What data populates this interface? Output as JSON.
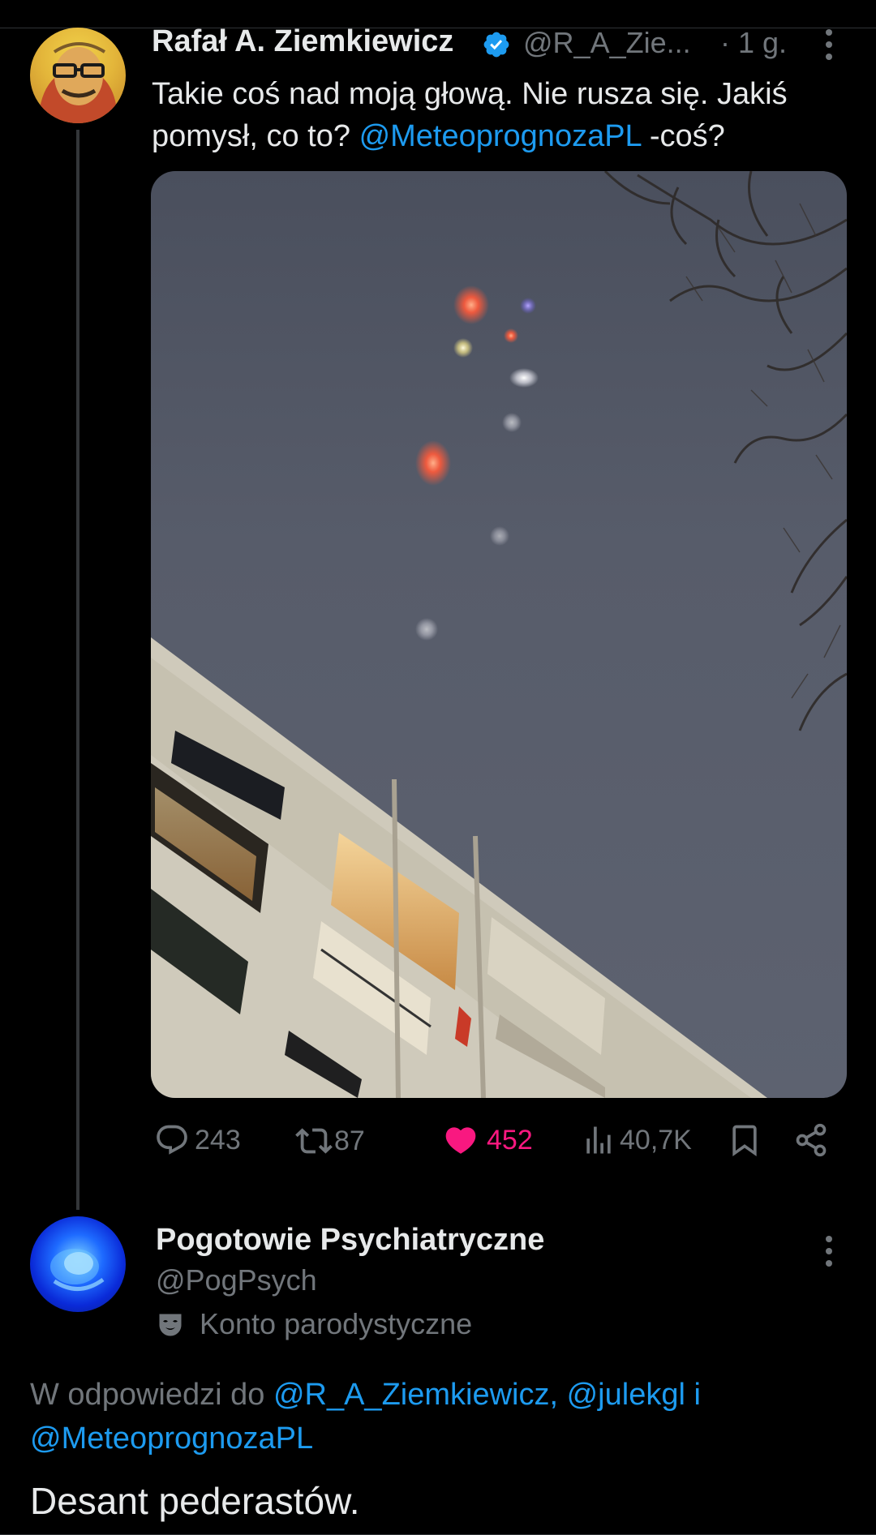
{
  "tweet": {
    "author_name": "Rafał A. Ziemkiewicz",
    "handle": "@R_A_Zie...",
    "time": "· 1 g.",
    "text_before": "Takie coś nad moją głową. Nie rusza się. Jakiś pomysł, co to? ",
    "mention": "@MeteoprognozaPL",
    "text_after": " -coś?",
    "stats": {
      "replies": "243",
      "retweets": "87",
      "likes": "452",
      "views": "40,7K"
    }
  },
  "reply": {
    "author_name": "Pogotowie Psychiatryczne",
    "handle": "@PogPsych",
    "label": "Konto parodystyczne",
    "reply_prefix": "W odpowiedzi do ",
    "reply_mention1": "@R_A_Ziemkiewicz,",
    "reply_mention2": "@julekgl",
    "reply_and": " i",
    "reply_mention3": "@MeteoprognozaPL",
    "text": "Desant pederastów."
  },
  "colors": {
    "accent": "#1d9bf0",
    "like": "#f91880",
    "muted": "#71767b",
    "text": "#e7e9ea",
    "background": "#000000"
  },
  "icons": [
    "verified-badge-icon",
    "more-icon",
    "reply-icon",
    "retweet-icon",
    "heart-icon",
    "views-icon",
    "bookmark-icon",
    "share-icon",
    "parody-mask-icon"
  ]
}
